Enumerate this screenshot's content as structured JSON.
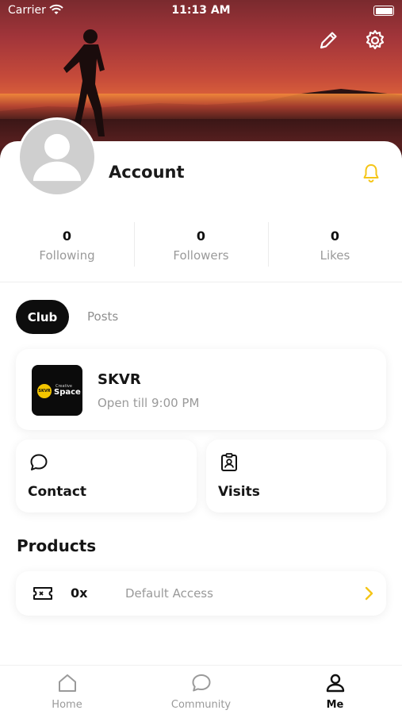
{
  "status_bar": {
    "carrier": "Carrier",
    "time": "11:13 AM"
  },
  "profile": {
    "name": "Account"
  },
  "stats": [
    {
      "value": "0",
      "label": "Following"
    },
    {
      "value": "0",
      "label": "Followers"
    },
    {
      "value": "0",
      "label": "Likes"
    }
  ],
  "tabs": {
    "club": "Club",
    "posts": "Posts"
  },
  "club": {
    "name": "SKVR",
    "hours": "Open till 9:00 PM",
    "logo_badge": "SKVR",
    "logo_small": "Creative",
    "logo_text": "Space"
  },
  "actions": {
    "contact": "Contact",
    "visits": "Visits"
  },
  "products": {
    "title": "Products",
    "items": [
      {
        "qty": "0x",
        "name": "Default Access"
      }
    ]
  },
  "tabbar": {
    "home": "Home",
    "community": "Community",
    "me": "Me"
  },
  "colors": {
    "accent": "#F5C518",
    "dark": "#0D0D0D",
    "muted": "#9A9A9A"
  },
  "icons": [
    "edit-icon",
    "settings-icon",
    "bell-icon",
    "chat-icon",
    "badge-icon",
    "ticket-icon",
    "chevron-right-icon",
    "home-icon",
    "community-icon",
    "profile-icon"
  ]
}
